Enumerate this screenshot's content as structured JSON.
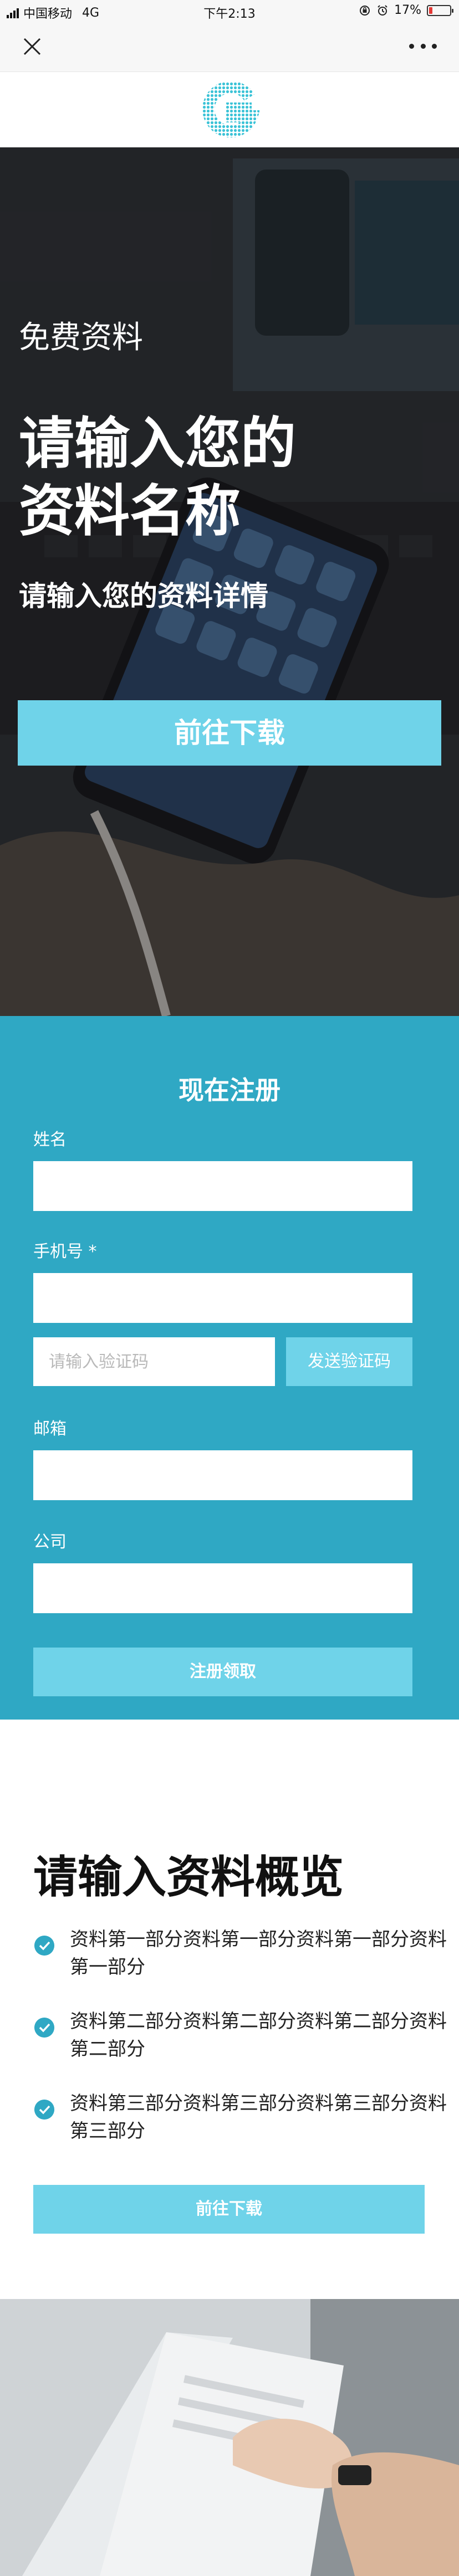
{
  "status_bar": {
    "carrier": "中国移动",
    "network": "4G",
    "time": "下午2:13",
    "battery_text": "17%",
    "battery_level": 0.17
  },
  "nav": {
    "close_icon": "close-icon",
    "more_icon": "more-icon"
  },
  "hero": {
    "subtitle": "免费资料",
    "title_line1": "请输入您的",
    "title_line2": "资料名称",
    "description": "请输入您的资料详情",
    "button": "前往下载"
  },
  "form": {
    "title": "现在注册",
    "name_label": "姓名",
    "phone_label": "手机号 *",
    "code_placeholder": "请输入验证码",
    "code_button": "发送验证码",
    "email_label": "邮箱",
    "company_label": "公司",
    "submit": "注册领取"
  },
  "overview": {
    "title": "请输入资料概览",
    "items": [
      "资料第一部分资料第一部分资料第一部分资料第一部分",
      "资料第二部分资料第二部分资料第二部分资料第二部分",
      "资料第三部分资料第三部分资料第三部分资料第三部分"
    ],
    "button": "前往下载"
  },
  "colors": {
    "accent": "#2fa8c4",
    "button": "#6fd3e9",
    "hero_text": "#ffffff"
  }
}
